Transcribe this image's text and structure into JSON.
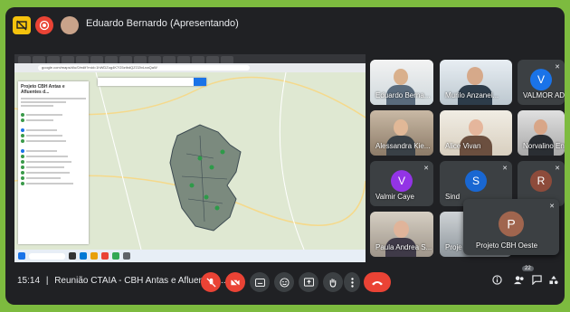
{
  "topbar": {
    "presenter_title": "Eduardo Bernardo (Apresentando)"
  },
  "shared_screen": {
    "url_text": "google.com/maps/d/u/0/edit?mid=1hWDZog4K7G5ztbdQZO2ivLnaQaW",
    "map_panel_title": "Projeto CBH Antas e Afluentes d..."
  },
  "participants": [
    {
      "name": "Eduardo Berna...",
      "type": "photo"
    },
    {
      "name": "Murilo Anzanel...",
      "type": "photo"
    },
    {
      "name": "VALMOR ADÃ...",
      "type": "avatar",
      "initial": "V",
      "color": "#1a73e8"
    },
    {
      "name": "Alessandra Kie...",
      "type": "photo"
    },
    {
      "name": "Alice Vivan",
      "type": "photo"
    },
    {
      "name": "Norvalino Engel",
      "type": "photo"
    },
    {
      "name": "Valmir Caye",
      "type": "avatar",
      "initial": "V",
      "color": "#9334e6"
    },
    {
      "name": "Sind",
      "type": "avatar",
      "initial": "S",
      "color": "#1967d2"
    },
    {
      "name": "",
      "type": "avatar",
      "initial": "R",
      "color": "#8d4b3b"
    },
    {
      "name": "Paula Andrea S...",
      "type": "photo"
    },
    {
      "name": "Proje",
      "type": "photo"
    }
  ],
  "floating_tile": {
    "name": "Projeto CBH Oeste",
    "initial": "P",
    "color": "#a0654e"
  },
  "bottombar": {
    "time": "15:14",
    "separator": "|",
    "meeting_title": "Reunião CTAIA - CBH Antas e Afluentes ...",
    "participant_count": "22"
  },
  "colors": {
    "background_border": "#7dbb3f",
    "meet_dark": "#202124",
    "tile": "#3c4043",
    "danger": "#ea4335"
  }
}
